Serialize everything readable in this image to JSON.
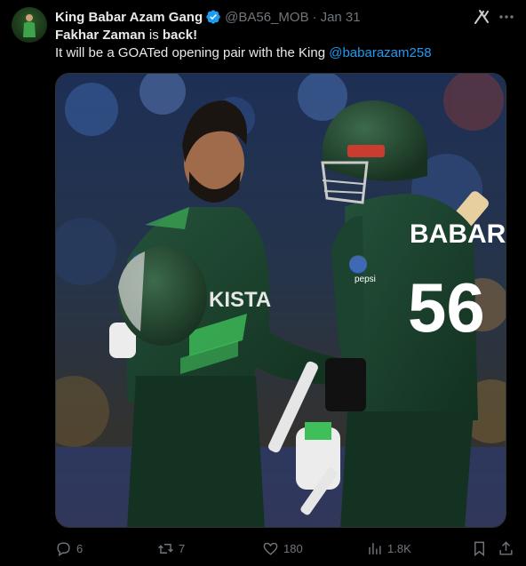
{
  "tweet": {
    "author_name": "King Babar Azam Gang",
    "handle": "@BA56_MOB",
    "separator": "·",
    "date": "Jan 31",
    "text_bold1": "Fakhar Zaman",
    "text_mid1": " is ",
    "text_bold2": "back!",
    "text_line2": "It will be a GOATed opening pair with the King ",
    "mention": "@babarazam258",
    "image_jersey_text": "BABAR",
    "image_jersey_number": "56",
    "image_chest_text": "KISTA",
    "image_logo_text": "pepsi"
  },
  "actions": {
    "replies": "6",
    "reposts": "7",
    "likes": "180",
    "views": "1.8K"
  },
  "colors": {
    "link": "#1d9bf0",
    "verified": "#1d9bf0",
    "muted": "#71767b",
    "background": "#000000"
  }
}
